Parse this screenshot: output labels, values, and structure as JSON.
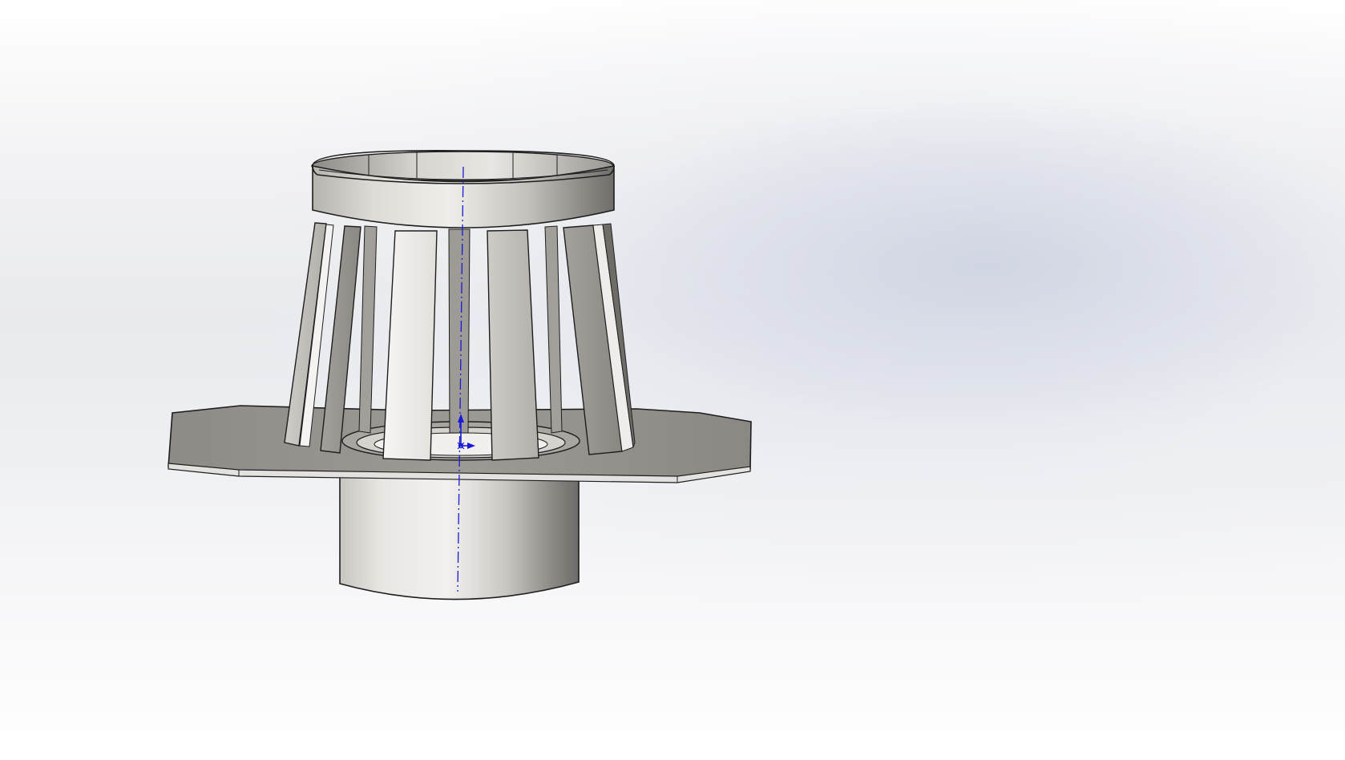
{
  "window": {
    "title": ""
  },
  "model": {
    "name": "roof-drain-strainer",
    "parts": [
      "strainer-top-ring",
      "strainer-bars",
      "flange-plate",
      "outlet-pipe"
    ],
    "axis_color": "#1a1ad6",
    "body_color": "#b9b6b2"
  },
  "icons": [
    "axis-origin-icon"
  ]
}
